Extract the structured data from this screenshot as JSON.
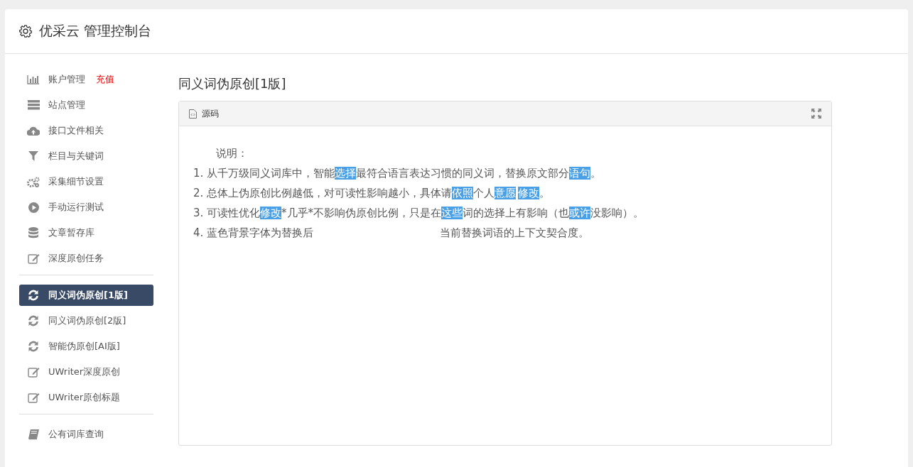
{
  "header": {
    "title": "优采云 管理控制台"
  },
  "sidebar": {
    "groups": [
      {
        "items": [
          {
            "label": "账户管理",
            "badge": "充值",
            "selected": false
          },
          {
            "label": "站点管理",
            "selected": false
          },
          {
            "label": "接口文件相关",
            "selected": false
          },
          {
            "label": "栏目与关键词",
            "selected": false
          },
          {
            "label": "采集细节设置",
            "selected": false
          },
          {
            "label": "手动运行测试",
            "selected": false
          },
          {
            "label": "文章暂存库",
            "selected": false
          },
          {
            "label": "深度原创任务",
            "selected": false
          }
        ]
      },
      {
        "items": [
          {
            "label": "同义词伪原创[1版]",
            "selected": true
          },
          {
            "label": "同义词伪原创[2版]",
            "selected": false
          },
          {
            "label": "智能伪原创[AI版]",
            "selected": false
          },
          {
            "label": "UWriter深度原创",
            "selected": false
          },
          {
            "label": "UWriter原创标题",
            "selected": false
          }
        ]
      },
      {
        "items": [
          {
            "label": "公有词库查询",
            "selected": false
          }
        ]
      }
    ]
  },
  "page_title": "同义词伪原创[1版]",
  "editor": {
    "tab": "源码",
    "heading": "说明：",
    "lines": [
      [
        {
          "text": "1. 从千万级同义词库中，智能",
          "highlight": false
        },
        {
          "text": "选择",
          "highlight": true
        },
        {
          "text": "最符合语言表达习惯的同义词，替换原文部分",
          "highlight": false
        },
        {
          "text": "语句",
          "highlight": true
        },
        {
          "text": "。",
          "highlight": false
        }
      ],
      [
        {
          "text": "2. 总体上伪原创比例越低，对可读性影响越小，具体请",
          "highlight": false
        },
        {
          "text": "依照",
          "highlight": true
        },
        {
          "text": "个人",
          "highlight": false
        },
        {
          "text": "意愿",
          "highlight": true
        },
        {
          "text": "修改",
          "highlight": true
        },
        {
          "text": "。",
          "highlight": false
        }
      ],
      [
        {
          "text": "3. 可读性优化",
          "highlight": false
        },
        {
          "text": "修改",
          "highlight": true
        },
        {
          "text": "*几乎*不影响伪原创比例，只是在",
          "highlight": false
        },
        {
          "text": "这些",
          "highlight": true
        },
        {
          "text": "词的选择上有影响（也",
          "highlight": false
        },
        {
          "text": "或许",
          "highlight": true
        },
        {
          "text": "没影响）。",
          "highlight": false
        }
      ]
    ],
    "line_4_fragments": [
      "4. 蓝色背景字体为替换后",
      "当前替换词语的上下文契合度。"
    ]
  }
}
